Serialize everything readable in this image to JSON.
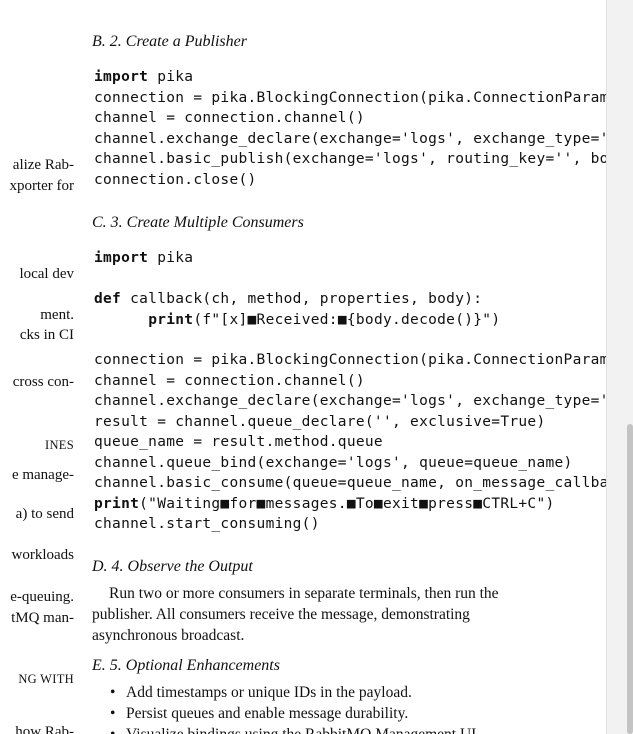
{
  "left_fragments": [
    {
      "text": "alize Rab-",
      "small_caps": false
    },
    {
      "text": "xporter for",
      "small_caps": false
    },
    {
      "text": "local dev",
      "small_caps": false
    },
    {
      "text": "ment.",
      "small_caps": false
    },
    {
      "text": "cks in CI",
      "small_caps": false
    },
    {
      "text": "cross con-",
      "small_caps": false
    },
    {
      "text": "INES",
      "small_caps": true
    },
    {
      "text": "e manage-",
      "small_caps": false
    },
    {
      "text": "a) to send",
      "small_caps": false
    },
    {
      "text": "workloads",
      "small_caps": false
    },
    {
      "text": "e-queuing.",
      "small_caps": false
    },
    {
      "text": "tMQ man-",
      "small_caps": false
    },
    {
      "text": "NG WITH",
      "small_caps": true
    },
    {
      "text": "how Rab-",
      "small_caps": false
    }
  ],
  "sections": {
    "publisher": {
      "heading": "B. 2. Create a Publisher",
      "code": [
        {
          "kw": "import",
          "rest": " pika"
        },
        {
          "kw": "",
          "rest": "connection = pika.BlockingConnection(pika.ConnectionParameters('localhost'))"
        },
        {
          "kw": "",
          "rest": "channel = connection.channel()"
        },
        {
          "kw": "",
          "rest": "channel.exchange_declare(exchange='logs', exchange_type='fanout')"
        },
        {
          "kw": "",
          "rest": "channel.basic_publish(exchange='logs', routing_key='', body='Hello')"
        },
        {
          "kw": "",
          "rest": "connection.close()"
        }
      ]
    },
    "consumers": {
      "heading": "C. 3. Create Multiple Consumers",
      "code_import": [
        {
          "kw": "import",
          "rest": " pika"
        }
      ],
      "code_def": [
        {
          "kw": "def",
          "rest": " callback(ch, method, properties, body):"
        },
        {
          "indent": "      ",
          "kw": "print",
          "rest": "(f\"[x]■Received:■{body.decode()}\")"
        }
      ],
      "code_main": [
        {
          "kw": "",
          "rest": "connection = pika.BlockingConnection(pika.ConnectionParameters('localhost'))"
        },
        {
          "kw": "",
          "rest": "channel = connection.channel()"
        },
        {
          "kw": "",
          "rest": "channel.exchange_declare(exchange='logs', exchange_type='fanout')"
        },
        {
          "kw": "",
          "rest": "result = channel.queue_declare('', exclusive=True)"
        },
        {
          "kw": "",
          "rest": "queue_name = result.method.queue"
        },
        {
          "kw": "",
          "rest": "channel.queue_bind(exchange='logs', queue=queue_name)"
        },
        {
          "kw": "",
          "rest": "channel.basic_consume(queue=queue_name, on_message_callback=callback)"
        },
        {
          "kw": "print",
          "rest": "(\"Waiting■for■messages.■To■exit■press■CTRL+C\")"
        },
        {
          "kw": "",
          "rest": "channel.start_consuming()"
        }
      ]
    },
    "observe": {
      "heading": "D. 4. Observe the Output",
      "paragraph": "Run two or more consumers in separate terminals, then run the publisher. All consumers receive the message, demonstrating asynchronous broadcast."
    },
    "enhancements": {
      "heading": "E. 5. Optional Enhancements",
      "items": [
        "Add timestamps or unique IDs in the payload.",
        "Persist queues and enable message durability.",
        "Visualize bindings using the RabbitMQ Management UI."
      ]
    }
  }
}
